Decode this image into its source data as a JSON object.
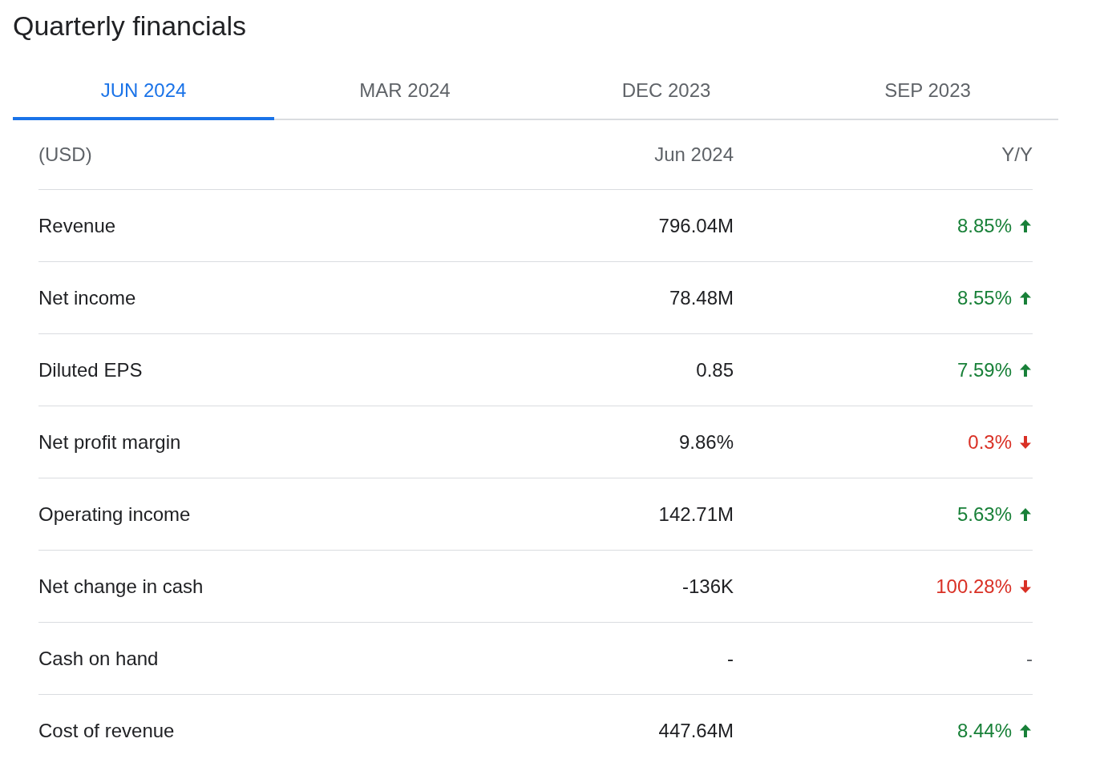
{
  "title": "Quarterly financials",
  "tabs": [
    {
      "label": "JUN 2024",
      "selected": true
    },
    {
      "label": "MAR 2024",
      "selected": false
    },
    {
      "label": "DEC 2023",
      "selected": false
    },
    {
      "label": "SEP 2023",
      "selected": false
    }
  ],
  "table": {
    "columns": [
      "(USD)",
      "Jun 2024",
      "Y/Y"
    ],
    "rows": [
      {
        "label": "Revenue",
        "value": "796.04M",
        "change": "8.85%",
        "kind": "up"
      },
      {
        "label": "Net income",
        "value": "78.48M",
        "change": "8.55%",
        "kind": "up"
      },
      {
        "label": "Diluted EPS",
        "value": "0.85",
        "change": "7.59%",
        "kind": "up"
      },
      {
        "label": "Net profit margin",
        "value": "9.86%",
        "change": "0.3%",
        "kind": "down"
      },
      {
        "label": "Operating income",
        "value": "142.71M",
        "change": "5.63%",
        "kind": "up"
      },
      {
        "label": "Net change in cash",
        "value": "-136K",
        "change": "100.28%",
        "kind": "down"
      },
      {
        "label": "Cash on hand",
        "value": "-",
        "change": "-",
        "kind": "none"
      },
      {
        "label": "Cost of revenue",
        "value": "447.64M",
        "change": "8.44%",
        "kind": "up"
      }
    ]
  }
}
